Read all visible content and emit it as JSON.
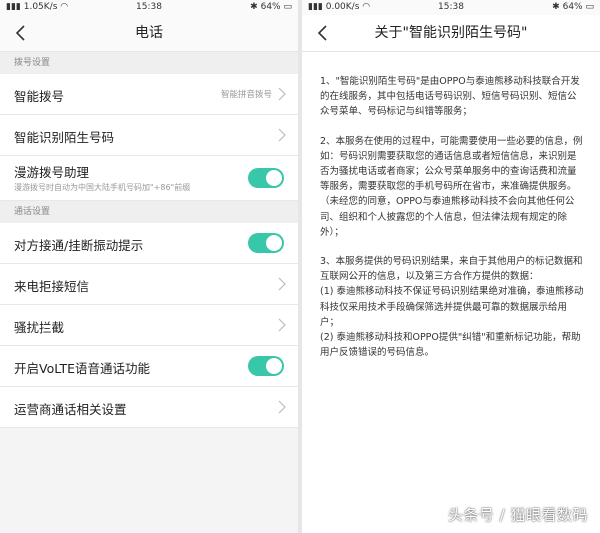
{
  "left": {
    "status": {
      "signal_speed": "1.05K/s",
      "time": "15:38",
      "battery": "64%"
    },
    "title": "电话",
    "sections": [
      {
        "header": "拨号设置",
        "items": [
          {
            "label": "智能拨号",
            "value": "智能拼音拨号",
            "control": "chevron"
          },
          {
            "label": "智能识别陌生号码",
            "control": "chevron"
          },
          {
            "label": "漫游拨号助理",
            "sub": "漫游拨号时自动为中国大陆手机号码加\"+86\"前缀",
            "control": "toggle",
            "on": true
          }
        ]
      },
      {
        "header": "通话设置",
        "items": [
          {
            "label": "对方接通/挂断振动提示",
            "control": "toggle",
            "on": true
          },
          {
            "label": "来电拒接短信",
            "control": "chevron"
          },
          {
            "label": "骚扰拦截",
            "control": "chevron"
          },
          {
            "label": "开启VoLTE语音通话功能",
            "control": "toggle",
            "on": true
          },
          {
            "label": "运营商通话相关设置",
            "control": "chevron"
          }
        ]
      }
    ]
  },
  "right": {
    "status": {
      "signal_speed": "0.00K/s",
      "time": "15:38",
      "battery": "64%"
    },
    "title": "关于\"智能识别陌生号码\"",
    "paragraphs": [
      "1、\"智能识别陌生号码\"是由OPPO与泰迪熊移动科技联合开发的在线服务，其中包括电话号码识别、短信号码识别、短信公众号菜单、号码标记与纠错等服务；",
      "2、本服务在使用的过程中，可能需要使用一些必要的信息，例如：号码识别需要获取您的通话信息或者短信信息，来识别是否为骚扰电话或者商家；公众号菜单服务中的查询话费和流量等服务，需要获取您的手机号码所在省市，来准确提供服务。（未经您的同意，OPPO与泰迪熊移动科技不会向其他任何公司、组织和个人披露您的个人信息，但法律法规有规定的除外）；",
      "3、本服务提供的号码识别结果，来自于其他用户的标记数据和互联网公开的信息，以及第三方合作方提供的数据：\n  (1) 泰迪熊移动科技不保证号码识别结果绝对准确，泰迪熊移动科技仅采用技术手段确保筛选并提供最可靠的数据展示给用户；\n  (2) 泰迪熊移动科技和OPPO提供\"纠错\"和重新标记功能，帮助用户反馈错误的号码信息。"
    ]
  },
  "watermark": "头条号 / 猫眼看数码",
  "colors": {
    "toggle_on": "#39c7a9",
    "background": "#f4f4f4"
  },
  "icons": [
    "back-arrow-icon",
    "chevron-right-icon",
    "wifi-icon",
    "bluetooth-icon",
    "battery-icon"
  ]
}
